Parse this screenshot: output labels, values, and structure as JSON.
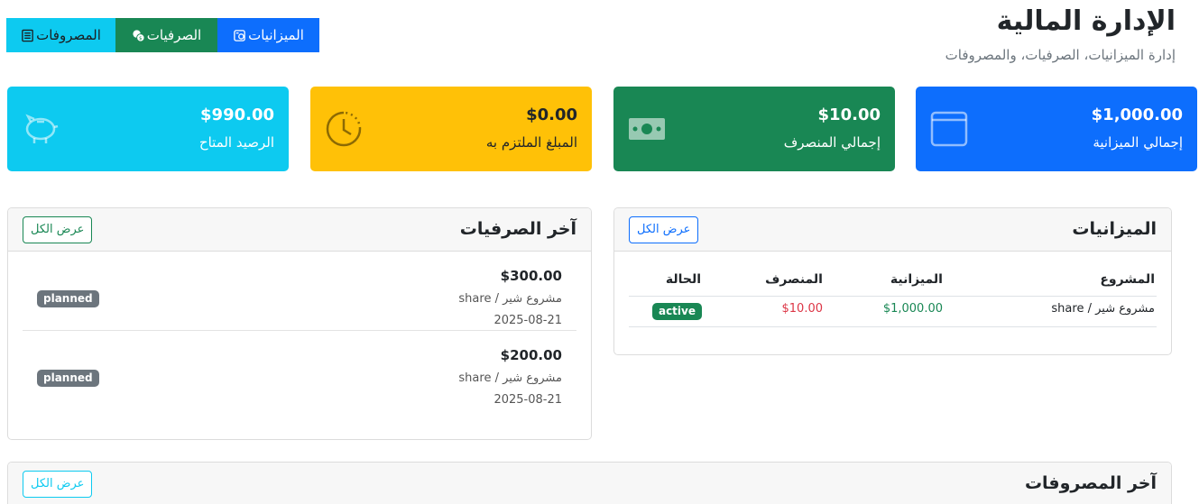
{
  "header": {
    "title": "الإدارة المالية",
    "subtitle": "إدارة الميزانيات، الصرفيات، والمصروفات"
  },
  "nav": {
    "budgets": "الميزانيات",
    "disbursements": "الصرفيات",
    "expenses": "المصروفات"
  },
  "stats": {
    "total_budget": {
      "value": "$1,000.00",
      "label": "إجمالي الميزانية",
      "icon": "wallet-icon"
    },
    "total_spent": {
      "value": "$10.00",
      "label": "إجمالي المنصرف",
      "icon": "cash-icon"
    },
    "committed": {
      "value": "$0.00",
      "label": "المبلغ الملتزم به",
      "icon": "clock-icon"
    },
    "available": {
      "value": "$990.00",
      "label": "الرصيد المتاح",
      "icon": "piggy-bank-icon"
    }
  },
  "budgets_panel": {
    "title": "الميزانيات",
    "view_all": "عرض الكل",
    "columns": {
      "project": "المشروع",
      "budget": "الميزانية",
      "spent": "المنصرف",
      "status": "الحالة"
    },
    "rows": [
      {
        "project": "مشروع شير / share",
        "budget": "$1,000.00",
        "spent": "$10.00",
        "status": "active"
      }
    ]
  },
  "disbursements_panel": {
    "title": "آخر الصرفيات",
    "view_all": "عرض الكل",
    "items": [
      {
        "amount": "$300.00",
        "project": "مشروع شير / share",
        "date": "2025-08-21",
        "status": "planned"
      },
      {
        "amount": "$200.00",
        "project": "مشروع شير / share",
        "date": "2025-08-21",
        "status": "planned"
      }
    ]
  },
  "expenses_panel": {
    "title": "آخر المصروفات",
    "view_all": "عرض الكل"
  },
  "colors": {
    "primary": "#0d6efd",
    "success": "#198754",
    "warning": "#ffc107",
    "info": "#0dcaf0",
    "danger": "#dc3545",
    "secondary": "#6c757d"
  }
}
